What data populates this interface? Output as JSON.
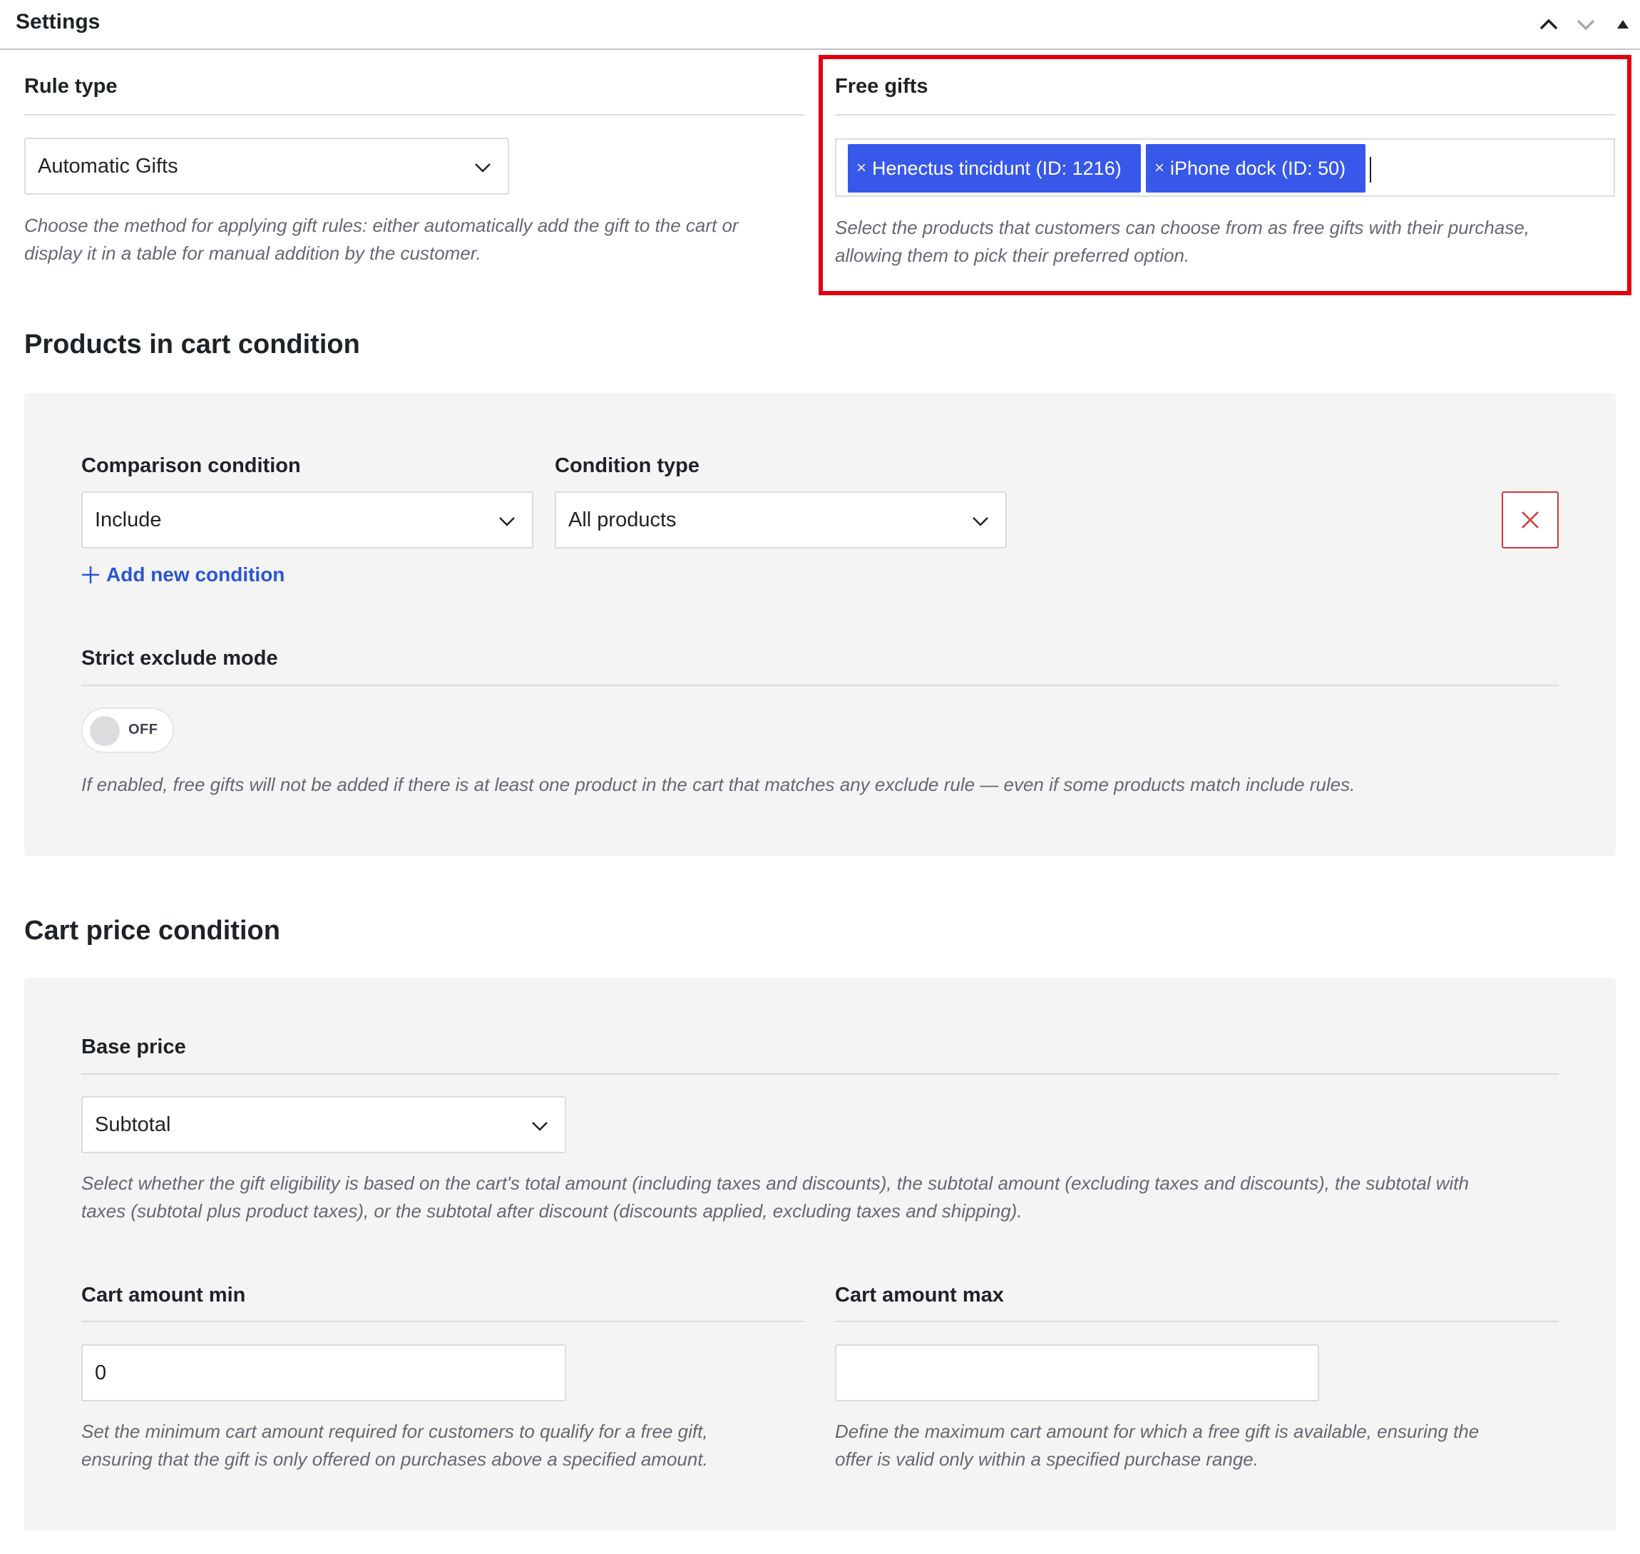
{
  "header": {
    "title": "Settings"
  },
  "rule_type": {
    "label": "Rule type",
    "selected": "Automatic Gifts",
    "description_line1": "Choose the method for applying gift rules: either automatically add the gift to the cart or",
    "description_line2": "display it in a table for manual addition by the customer."
  },
  "free_gifts": {
    "label": "Free gifts",
    "tokens": [
      {
        "remove": "×",
        "label": "Henectus tincidunt (ID: 1216)"
      },
      {
        "remove": "×",
        "label": "iPhone dock (ID: 50)"
      }
    ],
    "description_line1": "Select the products that customers can choose from as free gifts with their purchase,",
    "description_line2": "allowing them to pick their preferred option.",
    "highlight_color": "#e1000f"
  },
  "products_condition": {
    "title": "Products in cart condition",
    "comparison_label": "Comparison condition",
    "comparison_value": "Include",
    "type_label": "Condition type",
    "type_value": "All products",
    "add_new": "Add new condition",
    "strict_label": "Strict exclude mode",
    "toggle_text": "OFF",
    "strict_description": "If enabled, free gifts will not be added if there is at least one product in the cart that matches any exclude rule — even if some products match include rules."
  },
  "cart_price_condition": {
    "title": "Cart price condition",
    "base_label": "Base price",
    "base_value": "Subtotal",
    "base_description_line1": "Select whether the gift eligibility is based on the cart's total amount (including taxes and discounts), the subtotal amount (excluding taxes and discounts), the subtotal with",
    "base_description_line2": "taxes (subtotal plus product taxes), or the subtotal after discount (discounts applied, excluding taxes and shipping).",
    "min_label": "Cart amount min",
    "min_value": "0",
    "min_description_line1": "Set the minimum cart amount required for customers to qualify for a free gift,",
    "min_description_line2": "ensuring that the gift is only offered on purchases above a specified amount.",
    "max_label": "Cart amount max",
    "max_value": "",
    "max_description_line1": "Define the maximum cart amount for which a free gift is available, ensuring the",
    "max_description_line2": "offer is valid only within a specified purchase range."
  },
  "colors": {
    "accent": "#3858e9",
    "link": "#2a55d4",
    "danger": "#d63638",
    "panel_bg": "#f4f4f4"
  }
}
